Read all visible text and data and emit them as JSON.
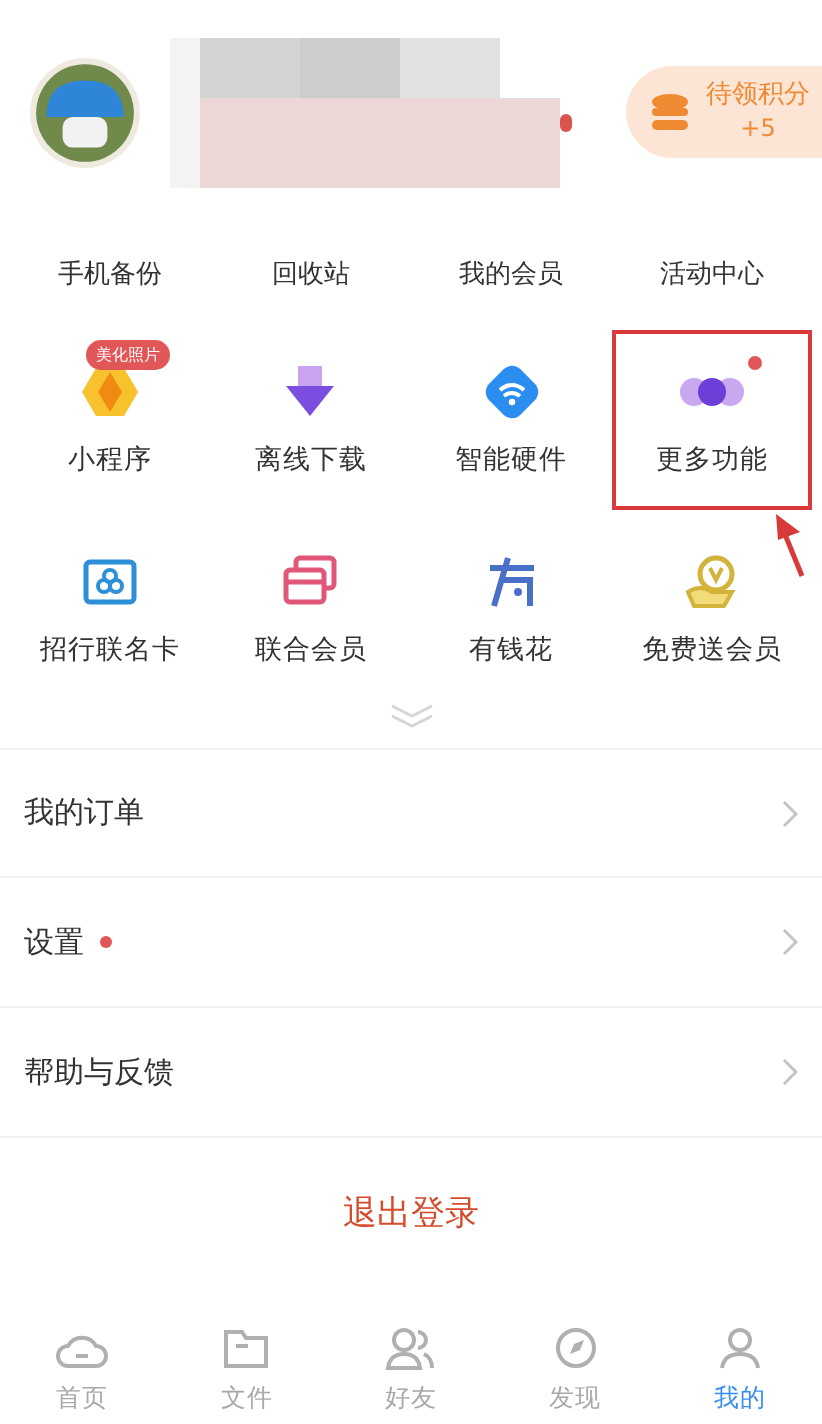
{
  "profile": {
    "notification_dot": true,
    "points": {
      "label": "待领积分",
      "value": "+5"
    }
  },
  "shortcuts": [
    "手机备份",
    "回收站",
    "我的会员",
    "活动中心"
  ],
  "features": [
    {
      "label": "小程序",
      "badge": "美化照片",
      "dot": false,
      "highlighted": false
    },
    {
      "label": "离线下载",
      "dot": false,
      "highlighted": false
    },
    {
      "label": "智能硬件",
      "dot": false,
      "highlighted": false
    },
    {
      "label": "更多功能",
      "dot": true,
      "highlighted": true
    },
    {
      "label": "招行联名卡",
      "dot": false,
      "highlighted": false
    },
    {
      "label": "联合会员",
      "dot": false,
      "highlighted": false
    },
    {
      "label": "有钱花",
      "dot": false,
      "highlighted": false
    },
    {
      "label": "免费送会员",
      "dot": false,
      "highlighted": false
    }
  ],
  "menu": [
    {
      "label": "我的订单",
      "dot": false
    },
    {
      "label": "设置",
      "dot": true
    },
    {
      "label": "帮助与反馈",
      "dot": false
    }
  ],
  "logout": "退出登录",
  "tabs": [
    {
      "label": "首页",
      "selected": false
    },
    {
      "label": "文件",
      "selected": false
    },
    {
      "label": "好友",
      "selected": false
    },
    {
      "label": "发现",
      "selected": false
    },
    {
      "label": "我的",
      "selected": true
    }
  ]
}
